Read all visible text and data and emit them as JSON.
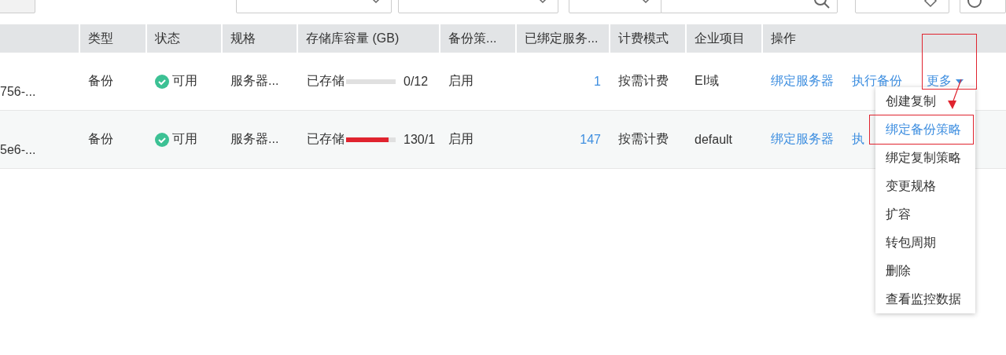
{
  "table": {
    "columns": [
      "类型",
      "状态",
      "规格",
      "存储库容量 (GB)",
      "备份策...",
      "已绑定服务...",
      "计费模式",
      "企业项目",
      "操作"
    ],
    "rows": [
      {
        "id": "756-...",
        "type": "备份",
        "status": "可用",
        "spec": "服务器...",
        "stored_label": "已存储",
        "usage": "0/12",
        "policy": "启用",
        "servers": "1",
        "billing": "按需计费",
        "project": "EI域",
        "actions": [
          {
            "label": "绑定服务器",
            "kind": "link"
          },
          {
            "label": "执行备份",
            "kind": "link"
          },
          {
            "label": "更多",
            "kind": "more"
          }
        ]
      },
      {
        "id": "5e6-...",
        "type": "备份",
        "status": "可用",
        "spec": "服务器...",
        "stored_label": "已存储",
        "level": 0.86,
        "usage": "130/1",
        "policy": "启用",
        "servers": "147",
        "billing": "按需计费",
        "project": "default",
        "actions": [
          {
            "label": "绑定服务器",
            "kind": "link"
          },
          {
            "label": "执",
            "kind": "link"
          }
        ]
      }
    ]
  },
  "menu": {
    "items": [
      {
        "label": "创建复制",
        "selected": false
      },
      {
        "label": "绑定备份策略",
        "selected": true
      },
      {
        "label": "绑定复制策略",
        "selected": false
      },
      {
        "label": "变更规格",
        "selected": false
      },
      {
        "label": "扩容",
        "selected": false
      },
      {
        "label": "转包周期",
        "selected": false
      },
      {
        "label": "删除",
        "selected": false
      },
      {
        "label": "查看监控数据",
        "selected": false
      }
    ]
  }
}
